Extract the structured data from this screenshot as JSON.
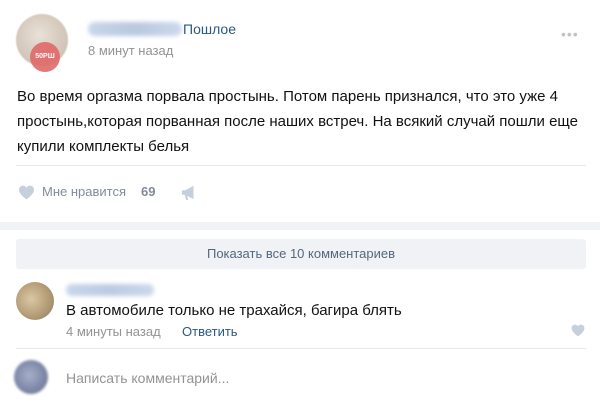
{
  "post": {
    "community_name": "Пошлое",
    "time": "8 минут назад",
    "avatar_badge": "50РШ",
    "text": "Во время оргазма порвала простынь. Потом парень признался, что это уже 4 простынь,которая порванная после наших встреч. На всякий случай пошли еще купили комплекты белья"
  },
  "actions": {
    "like_label": "Мне нравится",
    "like_count": "69"
  },
  "comments": {
    "show_all_label": "Показать все 10 комментариев",
    "items": [
      {
        "text": "В автомобиле только не трахайся, багира блять",
        "time": "4 минуты назад",
        "reply_label": "Ответить"
      }
    ]
  },
  "composer": {
    "placeholder": "Написать комментарий..."
  },
  "colors": {
    "link": "#2a5885",
    "muted": "#939393",
    "action": "#828a99",
    "band": "#f0f2f5"
  },
  "icons": [
    "more-icon",
    "heart-icon",
    "share-icon",
    "comment-heart-icon"
  ]
}
